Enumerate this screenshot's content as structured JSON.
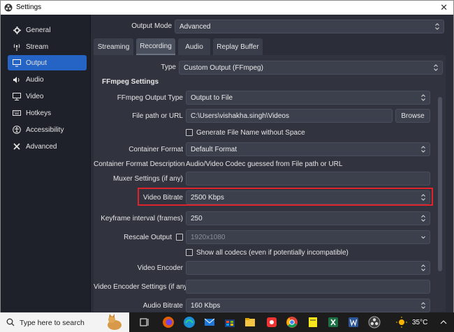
{
  "window": {
    "title": "Settings",
    "close_glyph": "✕"
  },
  "sidebar": {
    "items": [
      {
        "label": "General",
        "icon": "gear-icon",
        "glyph": "✿"
      },
      {
        "label": "Stream",
        "icon": "broadcast-icon",
        "glyph": "((•))"
      },
      {
        "label": "Output",
        "icon": "output-icon",
        "glyph": "▭"
      },
      {
        "label": "Audio",
        "icon": "speaker-icon",
        "glyph": "🔊"
      },
      {
        "label": "Video",
        "icon": "monitor-icon",
        "glyph": "▢"
      },
      {
        "label": "Hotkeys",
        "icon": "keyboard-icon",
        "glyph": "⌨"
      },
      {
        "label": "Accessibility",
        "icon": "accessibility-icon",
        "glyph": "◉"
      },
      {
        "label": "Advanced",
        "icon": "wrench-icon",
        "glyph": "✣"
      }
    ],
    "active_index": 2
  },
  "output_mode": {
    "label": "Output Mode",
    "value": "Advanced"
  },
  "tabs": [
    "Streaming",
    "Recording",
    "Audio",
    "Replay Buffer"
  ],
  "active_tab": "Recording",
  "type": {
    "label": "Type",
    "value": "Custom Output (FFmpeg)"
  },
  "ffmpeg": {
    "section_title": "FFmpeg Settings",
    "output_type": {
      "label": "FFmpeg Output Type",
      "value": "Output to File"
    },
    "file_path": {
      "label": "File path or URL",
      "value": "C:\\Users\\vishakha.singh\\Videos",
      "browse": "Browse"
    },
    "gen_filename": {
      "label": "Generate File Name without Space",
      "checked": false
    },
    "container_format": {
      "label": "Container Format",
      "value": "Default Format"
    },
    "container_desc": {
      "label": "Container Format Description",
      "value": "Audio/Video Codec guessed from File path or URL"
    },
    "muxer": {
      "label": "Muxer Settings (if any)",
      "value": ""
    },
    "video_bitrate": {
      "label": "Video Bitrate",
      "value": "2500 Kbps"
    },
    "keyframe": {
      "label": "Keyframe interval (frames)",
      "value": "250"
    },
    "rescale": {
      "label": "Rescale Output",
      "checked": false,
      "value": "1920x1080"
    },
    "show_codecs": {
      "label": "Show all codecs (even if potentially incompatible)",
      "checked": false
    },
    "video_encoder": {
      "label": "Video Encoder",
      "value": ""
    },
    "video_encoder_settings": {
      "label": "Video Encoder Settings (if any)",
      "value": ""
    },
    "audio_bitrate": {
      "label": "Audio Bitrate",
      "value": "160 Kbps"
    }
  },
  "taskbar": {
    "search_placeholder": "Type here to search",
    "temperature": "35°C"
  },
  "colors": {
    "accent": "#2563c4",
    "highlight": "#e0232b"
  }
}
